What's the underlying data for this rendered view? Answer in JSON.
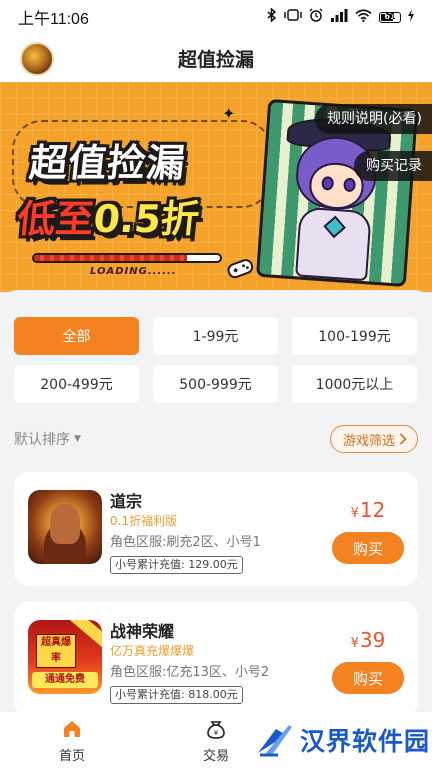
{
  "status_bar": {
    "time": "上午11:06",
    "icons": [
      "bluetooth-icon",
      "vibrate-icon",
      "alarm-icon",
      "signal-icon",
      "wifi-icon",
      "battery-icon",
      "charging-icon"
    ],
    "battery": "61"
  },
  "header": {
    "title": "超值捡漏"
  },
  "banner": {
    "title": "超值捡漏",
    "subtitle_prefix": "低至",
    "subtitle_highlight": "0.5折",
    "loading_text": "LOADING......",
    "loading_progress": 0.82,
    "rules_label": "规则说明(必看)",
    "records_label": "购买记录"
  },
  "price_filters": [
    {
      "label": "全部",
      "active": true
    },
    {
      "label": "1-99元",
      "active": false
    },
    {
      "label": "100-199元",
      "active": false
    },
    {
      "label": "200-499元",
      "active": false
    },
    {
      "label": "500-999元",
      "active": false
    },
    {
      "label": "1000元以上",
      "active": false
    }
  ],
  "sort": {
    "label": "默认排序",
    "game_filter_label": "游戏筛选"
  },
  "listings": [
    {
      "name": "道宗",
      "tag": "0.1折福利版",
      "server": "角色区服:刷充2区、小号1",
      "recharge": "小号累计充值: 129.00元",
      "currency": "¥",
      "price": "12",
      "buy_label": "购买"
    },
    {
      "name": "战神荣耀",
      "tag": "亿万真充爆爆爆",
      "server": "角色区服:亿充13区、小号2",
      "recharge": "小号累计充值: 818.00元",
      "currency": "¥",
      "price": "39",
      "buy_label": "购买",
      "icon_text": {
        "top": "超真爆率",
        "bottom": "通通免费"
      }
    }
  ],
  "bottom_nav": {
    "items": [
      {
        "label": "首页",
        "icon": "home-icon",
        "active": true
      },
      {
        "label": "交易",
        "icon": "trade-bag-icon",
        "active": false
      }
    ]
  },
  "watermark": {
    "text": "汉界软件园"
  },
  "colors": {
    "accent": "#f58220",
    "price": "#f0532a",
    "tag": "#e8a030",
    "banner": "#f5a22a"
  }
}
